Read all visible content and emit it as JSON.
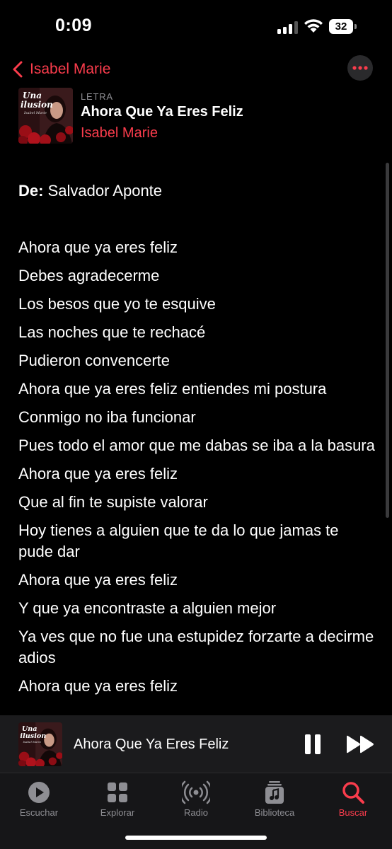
{
  "status_bar": {
    "time": "0:09",
    "battery": "32"
  },
  "nav": {
    "back_label": "Isabel Marie",
    "more_icon": "ellipsis-icon"
  },
  "song": {
    "eyebrow": "LETRA",
    "title": "Ahora Que Ya Eres Feliz",
    "artist": "Isabel Marie",
    "artwork_text_1": "Una",
    "artwork_text_2": "ilusion",
    "artwork_signature": "Isabel Marie"
  },
  "lyrics": {
    "credit_label": "De:",
    "credit_value": "Salvador Aponte",
    "lines": [
      "Ahora que ya eres feliz",
      "Debes agradecerme",
      "Los besos que yo te esquive",
      "Las noches que te rechacé",
      "Pudieron convencerte",
      "Ahora que ya eres feliz entiendes mi postura",
      "Conmigo no iba funcionar",
      "Pues todo el amor que me dabas se iba a la basura",
      "Ahora que ya eres feliz",
      "Que al fin te supiste valorar",
      "Hoy tienes a alguien que te da lo que jamas te pude dar",
      "Ahora que ya eres feliz",
      "Y que ya encontraste a alguien mejor",
      "Ya ves que no fue una estupidez forzarte a decirme adios",
      "Ahora que ya eres feliz"
    ]
  },
  "mini_player": {
    "title": "Ahora Que Ya Eres Feliz"
  },
  "tabs": [
    {
      "label": "Escuchar",
      "icon": "play-circle-icon",
      "active": false
    },
    {
      "label": "Explorar",
      "icon": "grid-icon",
      "active": false
    },
    {
      "label": "Radio",
      "icon": "radio-waves-icon",
      "active": false
    },
    {
      "label": "Biblioteca",
      "icon": "music-library-icon",
      "active": false
    },
    {
      "label": "Buscar",
      "icon": "search-icon",
      "active": true
    }
  ],
  "colors": {
    "accent": "#fa3c4c",
    "background": "#000000",
    "secondary_text": "#8e8e93"
  }
}
